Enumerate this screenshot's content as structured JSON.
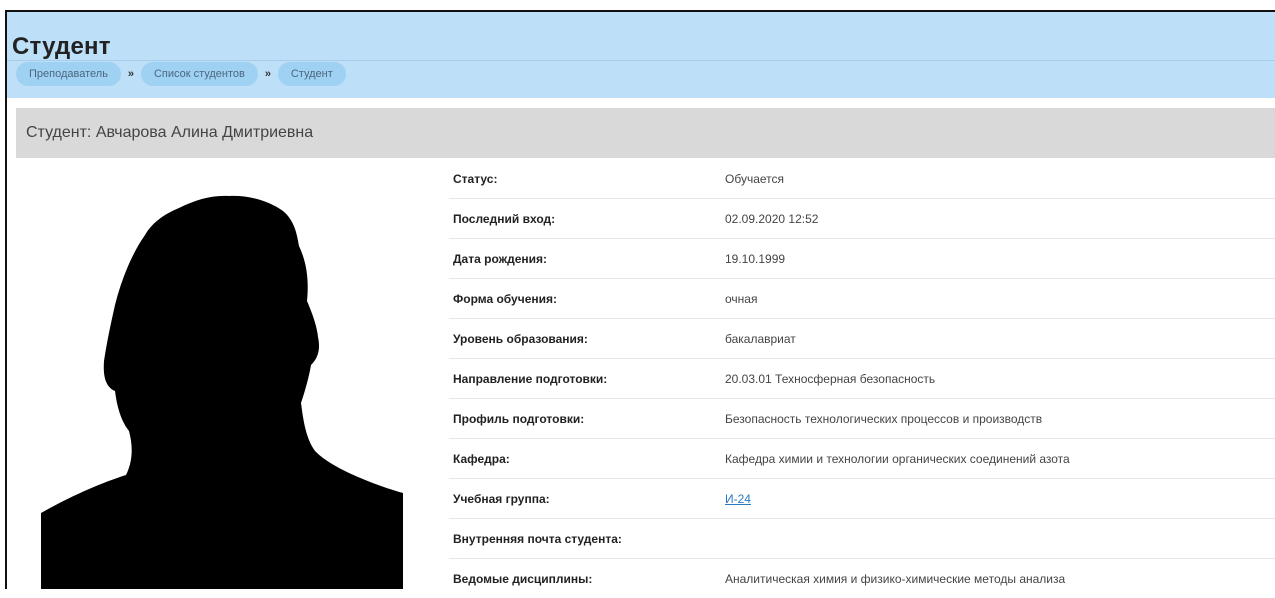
{
  "page": {
    "title": "Студент"
  },
  "breadcrumb": [
    {
      "label": "Преподаватель"
    },
    {
      "label": "Список студентов"
    },
    {
      "label": "Студент"
    }
  ],
  "breadcrumb_separator": "»",
  "card": {
    "header": "Студент: Авчарова Алина Дмитриевна"
  },
  "avatar": {
    "icon": "person-silhouette-icon",
    "color": "#000000"
  },
  "fields": [
    {
      "label": "Статус:",
      "value": "Обучается"
    },
    {
      "label": "Последний вход:",
      "value": "02.09.2020 12:52"
    },
    {
      "label": "Дата рождения:",
      "value": "19.10.1999"
    },
    {
      "label": "Форма обучения:",
      "value": "очная"
    },
    {
      "label": "Уровень образования:",
      "value": "бакалавриат"
    },
    {
      "label": "Направление подготовки:",
      "value": "20.03.01 Техносферная безопасность"
    },
    {
      "label": "Профиль подготовки:",
      "value": "Безопасность технологических процессов и производств"
    },
    {
      "label": "Кафедра:",
      "value": "Кафедра химии и технологии органических соединений азота"
    },
    {
      "label": "Учебная группа:",
      "value": "И-24",
      "link": true
    },
    {
      "label": "Внутренняя почта студента:",
      "value": ""
    },
    {
      "label": "Ведомые дисциплины:",
      "value": "Аналитическая химия и физико-химические методы анализа"
    }
  ],
  "colors": {
    "header_bg": "#bddff8",
    "crumb_bg": "#9fd2f2",
    "card_header_bg": "#d9d9d9",
    "link": "#2a7ac2"
  }
}
